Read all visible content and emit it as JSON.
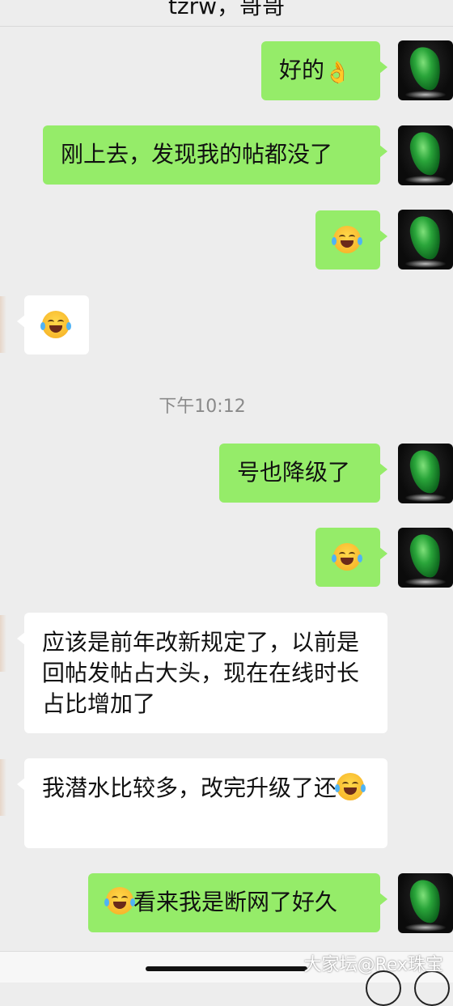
{
  "header": {
    "title": "tzrw，哥哥"
  },
  "timestamp": "下午10:12",
  "messages": [
    {
      "side": "out",
      "text": "好的",
      "emoji": "ok-hand-icon"
    },
    {
      "side": "out",
      "text": "刚上去，发现我的帖都没了"
    },
    {
      "side": "out",
      "emoji": "tears-of-joy-icon"
    },
    {
      "side": "in",
      "emoji": "loudly-laughing-icon"
    },
    {
      "side": "out",
      "text": "号也降级了"
    },
    {
      "side": "out",
      "emoji": "loudly-laughing-icon"
    },
    {
      "side": "in",
      "text": "应该是前年改新规定了，以前是回帖发帖占大头，现在在线时长占比增加了"
    },
    {
      "side": "in",
      "text": "我潜水比较多，改完升级了还",
      "emoji": "loudly-laughing-icon"
    },
    {
      "side": "out",
      "text": "看来我是断网了好久",
      "emoji": "loudly-laughing-icon"
    }
  ],
  "watermark": "大家坛@Rex珠宝",
  "colors": {
    "outgoing": "#95ec69",
    "incoming": "#ffffff",
    "background": "#ededed"
  }
}
